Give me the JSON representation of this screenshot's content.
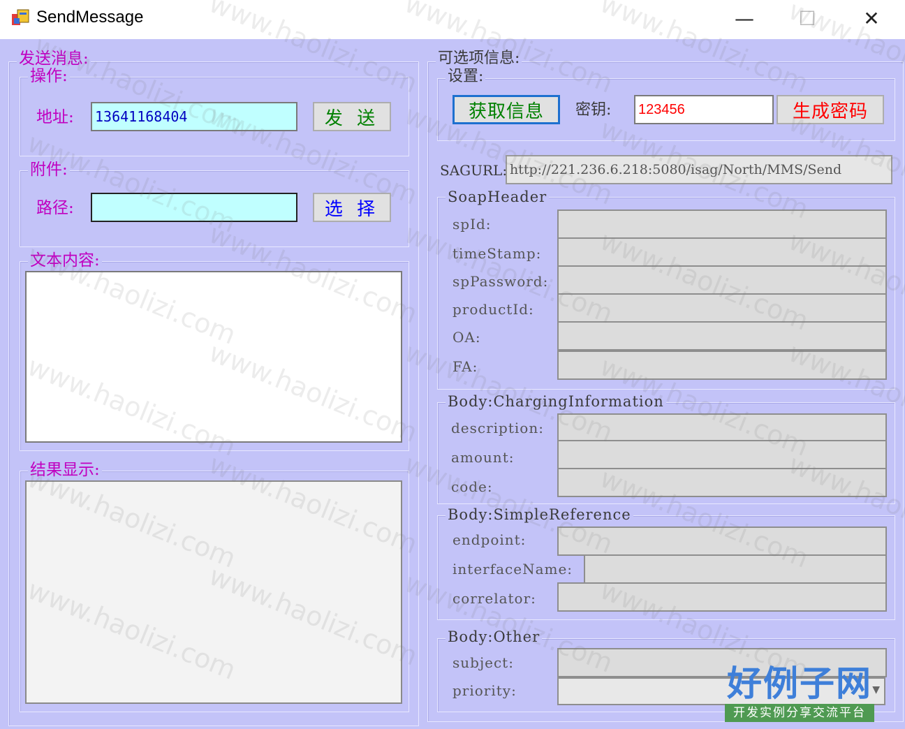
{
  "window": {
    "title": "SendMessage",
    "minimize_glyph": "—",
    "maximize_glyph": "☐",
    "close_glyph": "✕"
  },
  "left": {
    "send_group": "发送消息:",
    "op_group": "操作:",
    "address_label": "地址:",
    "address_value": "13641168404",
    "send_button": "发 送",
    "attach_group": "附件:",
    "path_label": "路径:",
    "path_value": "",
    "select_button": "选 择",
    "text_group": "文本内容:",
    "text_value": "",
    "result_group": "结果显示:",
    "result_value": ""
  },
  "right": {
    "optional_group": "可选项信息:",
    "settings_group": "设置:",
    "get_info_button": "获取信息",
    "key_label": "密钥:",
    "key_value": "123456",
    "gen_key_button": "生成密码",
    "sagurl_label": "SAGURL:",
    "sagurl_value": "http://221.236.6.218:5080/isag/North/MMS/Send",
    "soap_header": {
      "title": "SoapHeader",
      "fields": [
        "spId:",
        "timeStamp:",
        "spPassword:",
        "productId:",
        "OA:",
        "FA:"
      ]
    },
    "charging": {
      "title": "Body:ChargingInformation",
      "fields": [
        "description:",
        "amount:",
        "code:"
      ]
    },
    "simple_ref": {
      "title": "Body:SimpleReference",
      "fields": [
        "endpoint:",
        "interfaceName:",
        "correlator:"
      ]
    },
    "other": {
      "title": "Body:Other",
      "fields": [
        "subject:",
        "priority:"
      ]
    }
  },
  "watermark": {
    "text": "www.haolizi.com",
    "brand_main": "好例子网",
    "brand_sub": "开发实例分享交流平台"
  },
  "colors": {
    "background": "#c3c3f8",
    "label_magenta": "#c000c0",
    "input_cyan": "#c0ffff",
    "address_text": "#0000c0",
    "send_text": "#008000",
    "select_text": "#0000ff",
    "key_text": "#ff0000",
    "gen_key_text": "#ff0000",
    "brand_blue": "#3e7fd9",
    "brand_green": "#4f9a52"
  }
}
